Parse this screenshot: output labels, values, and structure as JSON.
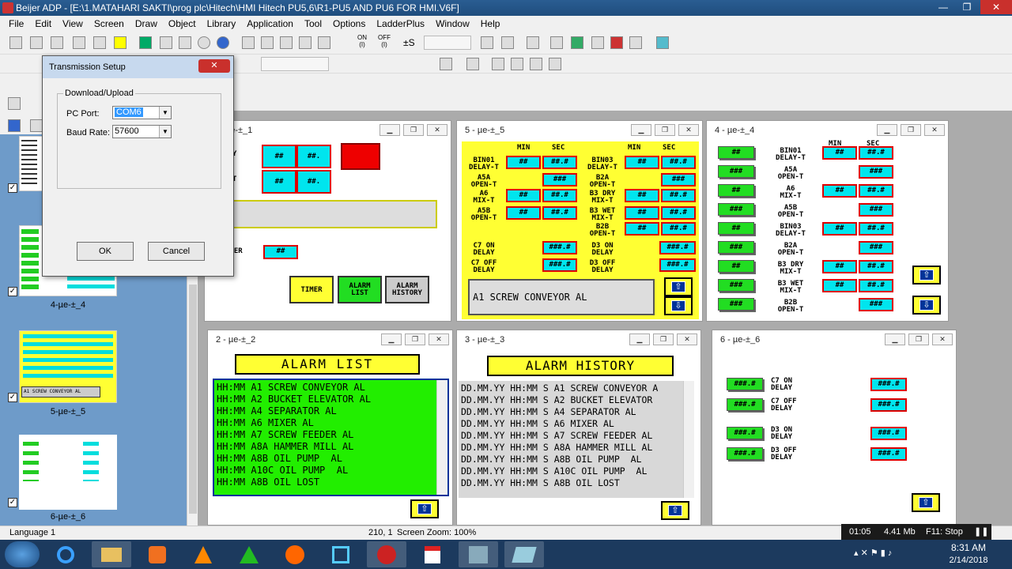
{
  "app": {
    "title": "Beijer ADP - [E:\\1.MATAHARI SAKTI\\prog plc\\Hitech\\HMI Hitech PU5,6\\R1-PU5 AND PU6 FOR HMI.V6F]"
  },
  "menu": [
    "File",
    "Edit",
    "View",
    "Screen",
    "Draw",
    "Object",
    "Library",
    "Application",
    "Tool",
    "Options",
    "LadderPlus",
    "Window",
    "Help"
  ],
  "toolbar": {
    "on_label": "ON",
    "off_label": "OFF",
    "io_on": "(I)",
    "io_off": "(I)",
    "pm_label": "±S"
  },
  "dialog": {
    "title": "Transmission Setup",
    "group": "Download/Upload",
    "pc_port_label": "PC Port:",
    "pc_port_value": "COM6",
    "baud_label": "Baud Rate:",
    "baud_value": "57600",
    "ok": "OK",
    "cancel": "Cancel"
  },
  "thumbs": [
    {
      "label": "4-µe-±_4"
    },
    {
      "label": "5-µe-±_5",
      "bar": "A1 SCREW CONVEYOR AL"
    },
    {
      "label": "6-µe-±_6"
    }
  ],
  "win1": {
    "title": "1 - µe-±_1",
    "dry_label": "DRY\n-T",
    "wet_label": "WET\n-T",
    "center_label": "NTER",
    "fields": [
      "##",
      "##.",
      "##",
      "##.",
      "##"
    ],
    "timer_btn": "TIMER",
    "alarm_list_btn": "ALARM\nLIST",
    "alarm_history_btn": "ALARM\nHISTORY"
  },
  "win5": {
    "title": "5 - µe-±_5",
    "min": "MIN",
    "sec": "SEC",
    "left_labels": [
      "BIN01\nDELAY-T",
      "A5A\nOPEN-T",
      "A6\nMIX-T",
      "A5B\nOPEN-T"
    ],
    "right_labels": [
      "BIN03\nDELAY-T",
      "B2A\nOPEN-T",
      "B3 DRY\nMIX-T",
      "B3 WET\nMIX-T",
      "B2B\nOPEN-T"
    ],
    "delay_labels_left": [
      "C7 ON\nDELAY",
      "C7 OFF\nDELAY"
    ],
    "delay_labels_right": [
      "D3 ON\nDELAY",
      "D3 OFF\nDELAY"
    ],
    "min_val": "##",
    "sec_val": "##.#",
    "sec_only": "###",
    "delay_val": "###.#",
    "message": "A1 SCREW CONVEYOR AL"
  },
  "win4": {
    "title": "4 - µe-±_4",
    "min": "MIN",
    "sec": "SEC",
    "green_vals": [
      "##",
      "###",
      "##",
      "###",
      "##",
      "###",
      "##",
      "###"
    ],
    "labels": [
      "BIN01\nDELAY-T",
      "A5A\nOPEN-T",
      "A6\nMIX-T",
      "A5B\nOPEN-T",
      "BIN03\nDELAY-T",
      "B2A\nOPEN-T",
      "B3 DRY\nMIX-T",
      "B3 WET\nMIX-T",
      "B2B\nOPEN-T"
    ],
    "min_val": "##",
    "sec_val": "##.#",
    "sec_only": "###"
  },
  "win2": {
    "title": "2 - µe-±_2",
    "header": "ALARM LIST",
    "rows": [
      "HH:MM A1 SCREW CONVEYOR AL",
      "HH:MM A2 BUCKET ELEVATOR AL",
      "HH:MM A4 SEPARATOR AL",
      "HH:MM A6 MIXER AL",
      "HH:MM A7 SCREW FEEDER AL",
      "HH:MM A8A HAMMER MILL AL",
      "HH:MM A8B OIL PUMP  AL",
      "HH:MM A10C OIL PUMP  AL",
      "HH:MM A8B OIL LOST"
    ]
  },
  "win3": {
    "title": "3 - µe-±_3",
    "header": "ALARM HISTORY",
    "rows": [
      "DD.MM.YY HH:MM S A1 SCREW CONVEYOR A",
      "DD.MM.YY HH:MM S A2 BUCKET ELEVATOR",
      "DD.MM.YY HH:MM S A4 SEPARATOR AL",
      "DD.MM.YY HH:MM S A6 MIXER AL",
      "DD.MM.YY HH:MM S A7 SCREW FEEDER AL",
      "DD.MM.YY HH:MM S A8A HAMMER MILL AL",
      "DD.MM.YY HH:MM S A8B OIL PUMP  AL",
      "DD.MM.YY HH:MM S A10C OIL PUMP  AL",
      "DD.MM.YY HH:MM S A8B OIL LOST"
    ]
  },
  "win6": {
    "title": "6 - µe-±_6",
    "vals": "###.#",
    "labels": [
      "C7 ON\nDELAY",
      "C7 OFF\nDELAY",
      "D3 ON\nDELAY",
      "D3 OFF\nDELAY"
    ]
  },
  "status": {
    "language": "Language 1",
    "coords": "210, 1",
    "zoom": "Screen Zoom: 100%",
    "time": "01:05",
    "mem": "4.41 Mb",
    "f11": "F11: Stop"
  },
  "taskbar": {
    "time": "8:31 AM",
    "date": "2/14/2018"
  },
  "colors": {
    "yellow": "#ffff33",
    "cyan": "#00e5ee",
    "green": "#22dd22",
    "red": "#ee0000",
    "navy": "#003399"
  }
}
